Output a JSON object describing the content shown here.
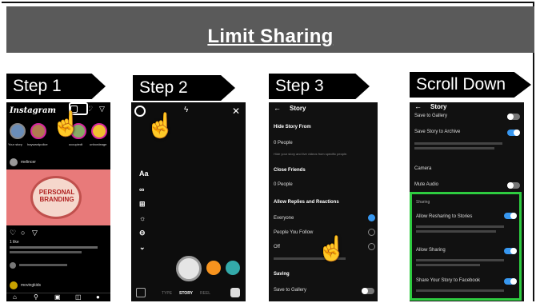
{
  "header": {
    "title": "Limit Sharing"
  },
  "steps": [
    {
      "label": "Step 1"
    },
    {
      "label": "Step 2"
    },
    {
      "label": "Step 3"
    },
    {
      "label": "Scroll Down"
    }
  ],
  "phone1": {
    "app_name": "Instagram",
    "stories": [
      "Your story",
      "haywardpolice",
      "occupiedt",
      "unbordeage"
    ],
    "banner": "PERSONAL BRANDING",
    "post_user": "melincer",
    "likes": "1 like",
    "bottom_user": "movingkids"
  },
  "phone2": {
    "tools": [
      "Aa",
      "∞",
      "⊞",
      "☼",
      "⊖",
      "⌄"
    ],
    "modes": [
      "TYPE",
      "STORY",
      "REEL"
    ]
  },
  "phone3": {
    "title": "Story",
    "hide_story_head": "Hide Story From",
    "hide_people": "0 People",
    "hide_desc": "Hide your story and live videos from specific people.",
    "close_friends_head": "Close Friends",
    "close_people": "0 People",
    "replies_head": "Allow Replies and Reactions",
    "everyone": "Everyone",
    "people_follow": "People You Follow",
    "off": "Off",
    "saving_head": "Saving",
    "save_gallery": "Save to Gallery"
  },
  "phone4": {
    "title": "Story",
    "save_gallery": "Save to Gallery",
    "save_archive": "Save Story to Archive",
    "camera": "Camera",
    "mute_audio": "Mute Audio",
    "sharing_head": "Sharing",
    "allow_reshare": "Allow Resharing to Stories",
    "allow_sharing": "Allow Sharing",
    "share_facebook": "Share Your Story to Facebook"
  },
  "colors": {
    "accent": "#3797f0",
    "highlight": "#2ecc40",
    "title_bar": "#5a5a5a"
  }
}
